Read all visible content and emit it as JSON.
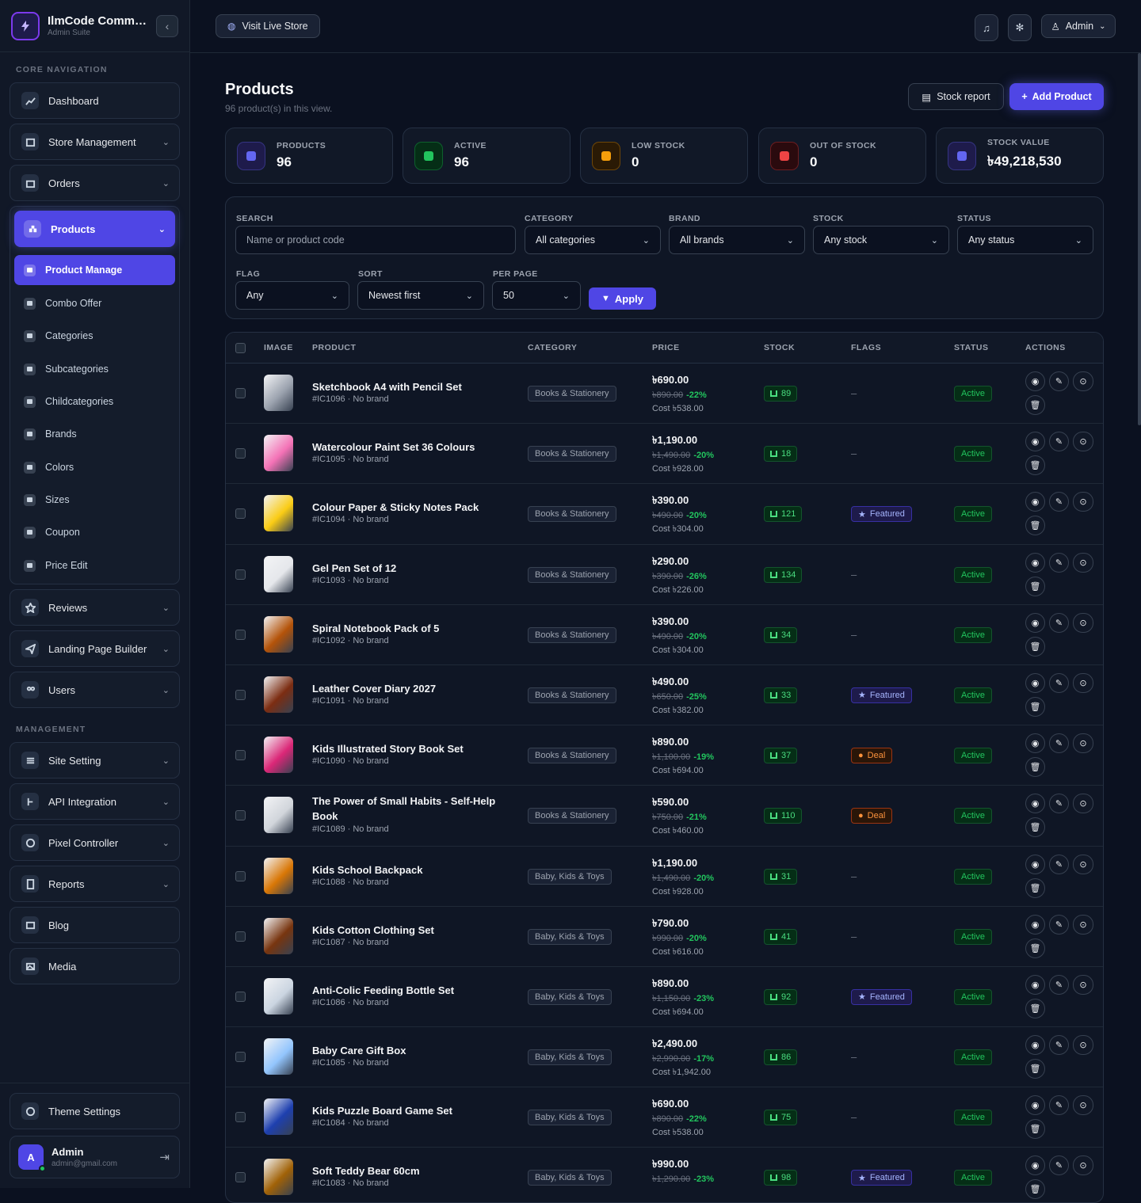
{
  "brand": {
    "title": "IlmCode Comme...",
    "subtitle": "Admin Suite"
  },
  "sidebar": {
    "core_label": "CORE NAVIGATION",
    "management_label": "MANAGEMENT",
    "items": {
      "dashboard": "Dashboard",
      "store": "Store Management",
      "orders": "Orders",
      "products": "Products",
      "reviews": "Reviews",
      "landing": "Landing Page Builder",
      "users": "Users",
      "site_setting": "Site Setting",
      "api": "API Integration",
      "pixel": "Pixel Controller",
      "reports": "Reports",
      "blog": "Blog",
      "media": "Media",
      "theme": "Theme Settings"
    },
    "product_sub": [
      "Product Manage",
      "Combo Offer",
      "Categories",
      "Subcategories",
      "Childcategories",
      "Brands",
      "Colors",
      "Sizes",
      "Coupon",
      "Price Edit"
    ],
    "user": {
      "name": "Admin",
      "email": "admin@gmail.com",
      "initial": "A"
    }
  },
  "topbar": {
    "visit": "Visit Live Store",
    "admin": "Admin"
  },
  "page": {
    "title": "Products",
    "subtitle": "96 product(s) in this view.",
    "stock_report": "Stock report",
    "add_product": "Add Product"
  },
  "stats": [
    {
      "label": "PRODUCTS",
      "value": "96",
      "color": "#6366f1",
      "bg": "#1e1b4b"
    },
    {
      "label": "ACTIVE",
      "value": "96",
      "color": "#22c55e",
      "bg": "#052e16"
    },
    {
      "label": "LOW STOCK",
      "value": "0",
      "color": "#f59e0b",
      "bg": "#2a1a05"
    },
    {
      "label": "OUT OF STOCK",
      "value": "0",
      "color": "#ef4444",
      "bg": "#2a0a0e"
    },
    {
      "label": "STOCK VALUE",
      "value": "৳49,218,530",
      "color": "#6366f1",
      "bg": "#1e1b4b"
    }
  ],
  "filters": {
    "search_label": "SEARCH",
    "search_placeholder": "Name or product code",
    "category_label": "CATEGORY",
    "category_value": "All categories",
    "brand_label": "BRAND",
    "brand_value": "All brands",
    "stock_label": "STOCK",
    "stock_value": "Any stock",
    "status_label": "STATUS",
    "status_value": "Any status",
    "flag_label": "FLAG",
    "flag_value": "Any",
    "sort_label": "SORT",
    "sort_value": "Newest first",
    "perpage_label": "PER PAGE",
    "perpage_value": "50",
    "apply": "Apply"
  },
  "table": {
    "headers": [
      "IMAGE",
      "PRODUCT",
      "CATEGORY",
      "PRICE",
      "STOCK",
      "FLAGS",
      "STATUS",
      "ACTIONS"
    ],
    "rows": [
      {
        "name": "Sketchbook A4 with Pencil Set",
        "code": "#IC1096 · No brand",
        "category": "Books & Stationery",
        "price": "৳690.00",
        "old": "৳890.00",
        "disc": "-22%",
        "cost": "Cost ৳538.00",
        "stock": "89",
        "flag": "",
        "status": "Active",
        "img": "#9ca3af"
      },
      {
        "name": "Watercolour Paint Set 36 Colours",
        "code": "#IC1095 · No brand",
        "category": "Books & Stationery",
        "price": "৳1,190.00",
        "old": "৳1,490.00",
        "disc": "-20%",
        "cost": "Cost ৳928.00",
        "stock": "18",
        "flag": "",
        "status": "Active",
        "img": "#f472b6"
      },
      {
        "name": "Colour Paper & Sticky Notes Pack",
        "code": "#IC1094 · No brand",
        "category": "Books & Stationery",
        "price": "৳390.00",
        "old": "৳490.00",
        "disc": "-20%",
        "cost": "Cost ৳304.00",
        "stock": "121",
        "flag": "Featured",
        "status": "Active",
        "img": "#facc15"
      },
      {
        "name": "Gel Pen Set of 12",
        "code": "#IC1093 · No brand",
        "category": "Books & Stationery",
        "price": "৳290.00",
        "old": "৳390.00",
        "disc": "-26%",
        "cost": "Cost ৳226.00",
        "stock": "134",
        "flag": "",
        "status": "Active",
        "img": "#e5e7eb"
      },
      {
        "name": "Spiral Notebook Pack of 5",
        "code": "#IC1092 · No brand",
        "category": "Books & Stationery",
        "price": "৳390.00",
        "old": "৳490.00",
        "disc": "-20%",
        "cost": "Cost ৳304.00",
        "stock": "34",
        "flag": "",
        "status": "Active",
        "img": "#b45309"
      },
      {
        "name": "Leather Cover Diary 2027",
        "code": "#IC1091 · No brand",
        "category": "Books & Stationery",
        "price": "৳490.00",
        "old": "৳650.00",
        "disc": "-25%",
        "cost": "Cost ৳382.00",
        "stock": "33",
        "flag": "Featured",
        "status": "Active",
        "img": "#7c2d12"
      },
      {
        "name": "Kids Illustrated Story Book Set",
        "code": "#IC1090 · No brand",
        "category": "Books & Stationery",
        "price": "৳890.00",
        "old": "৳1,100.00",
        "disc": "-19%",
        "cost": "Cost ৳694.00",
        "stock": "37",
        "flag": "Deal",
        "status": "Active",
        "img": "#db2777"
      },
      {
        "name": "The Power of Small Habits - Self-Help Book",
        "code": "#IC1089 · No brand",
        "category": "Books & Stationery",
        "price": "৳590.00",
        "old": "৳750.00",
        "disc": "-21%",
        "cost": "Cost ৳460.00",
        "stock": "110",
        "flag": "Deal",
        "status": "Active",
        "img": "#d1d5db"
      },
      {
        "name": "Kids School Backpack",
        "code": "#IC1088 · No brand",
        "category": "Baby, Kids & Toys",
        "price": "৳1,190.00",
        "old": "৳1,490.00",
        "disc": "-20%",
        "cost": "Cost ৳928.00",
        "stock": "31",
        "flag": "",
        "status": "Active",
        "img": "#d97706"
      },
      {
        "name": "Kids Cotton Clothing Set",
        "code": "#IC1087 · No brand",
        "category": "Baby, Kids & Toys",
        "price": "৳790.00",
        "old": "৳990.00",
        "disc": "-20%",
        "cost": "Cost ৳616.00",
        "stock": "41",
        "flag": "",
        "status": "Active",
        "img": "#78350f"
      },
      {
        "name": "Anti-Colic Feeding Bottle Set",
        "code": "#IC1086 · No brand",
        "category": "Baby, Kids & Toys",
        "price": "৳890.00",
        "old": "৳1,150.00",
        "disc": "-23%",
        "cost": "Cost ৳694.00",
        "stock": "92",
        "flag": "Featured",
        "status": "Active",
        "img": "#cbd5e1"
      },
      {
        "name": "Baby Care Gift Box",
        "code": "#IC1085 · No brand",
        "category": "Baby, Kids & Toys",
        "price": "৳2,490.00",
        "old": "৳2,990.00",
        "disc": "-17%",
        "cost": "Cost ৳1,942.00",
        "stock": "86",
        "flag": "",
        "status": "Active",
        "img": "#93c5fd"
      },
      {
        "name": "Kids Puzzle Board Game Set",
        "code": "#IC1084 · No brand",
        "category": "Baby, Kids & Toys",
        "price": "৳690.00",
        "old": "৳890.00",
        "disc": "-22%",
        "cost": "Cost ৳538.00",
        "stock": "75",
        "flag": "",
        "status": "Active",
        "img": "#1e40af"
      },
      {
        "name": "Soft Teddy Bear 60cm",
        "code": "#IC1083 · No brand",
        "category": "Baby, Kids & Toys",
        "price": "৳990.00",
        "old": "৳1,290.00",
        "disc": "-23%",
        "cost": "",
        "stock": "98",
        "flag": "Featured",
        "status": "Active",
        "img": "#a16207"
      }
    ]
  }
}
